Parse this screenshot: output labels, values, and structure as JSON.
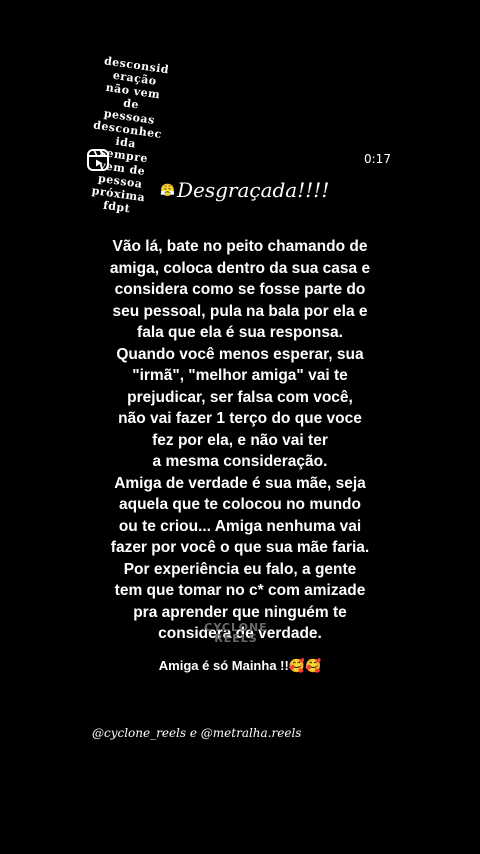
{
  "overlay": {
    "tilted_lines": [
      "desconsid",
      "eração",
      "não vem",
      "de",
      "pessoas",
      "desconhec",
      "ida",
      "sempre",
      "vem de",
      "pessoa",
      "próxima",
      "fdpt"
    ],
    "title_emoji": "😤",
    "title": "Desgraçada!!!!",
    "timer": "0:17"
  },
  "post": {
    "lines": [
      "Vão lá, bate no peito chamando de",
      "amiga, coloca dentro da sua casa e",
      "considera como se fosse parte do",
      "seu pessoal, pula na bala por ela e",
      "fala que ela é sua responsa.",
      "Quando você menos esperar, sua",
      "\"irmã\", \"melhor amiga\" vai te",
      "prejudicar, ser falsa com você,",
      "não vai fazer 1 terço do que voce",
      "fez por ela, e não vai ter",
      "a mesma consideração.",
      "Amiga de verdade é sua mãe, seja",
      "aquela que te colocou no mundo",
      "ou te criou... Amiga nenhuma vai",
      "fazer por você o que sua mãe faria.",
      "Por experiência eu falo, a gente",
      "tem que tomar no c* com amizade",
      "pra aprender que ninguém te",
      "considera de verdade."
    ],
    "watermark_line1": "CYCLONE",
    "watermark_line2": "REELS",
    "closing": "Amiga é só Mainha !!🥰🥰"
  },
  "credit": "@cyclone_reels e @metralha.reels"
}
